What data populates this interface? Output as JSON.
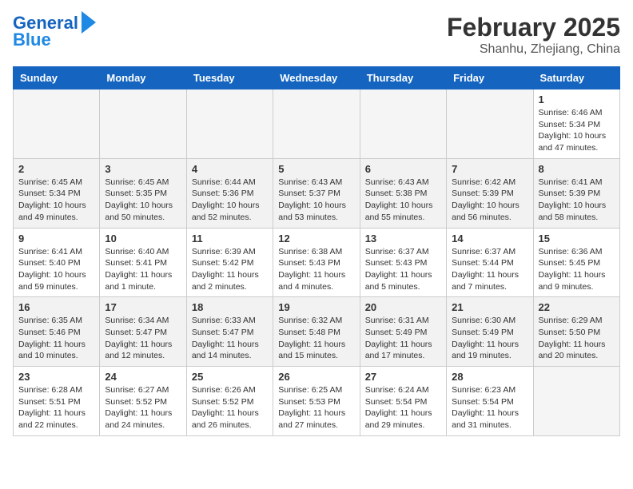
{
  "header": {
    "logo_line1": "General",
    "logo_line2": "Blue",
    "month_year": "February 2025",
    "location": "Shanhu, Zhejiang, China"
  },
  "weekdays": [
    "Sunday",
    "Monday",
    "Tuesday",
    "Wednesday",
    "Thursday",
    "Friday",
    "Saturday"
  ],
  "weeks": [
    [
      {
        "day": "",
        "empty": true
      },
      {
        "day": "",
        "empty": true
      },
      {
        "day": "",
        "empty": true
      },
      {
        "day": "",
        "empty": true
      },
      {
        "day": "",
        "empty": true
      },
      {
        "day": "",
        "empty": true
      },
      {
        "day": "1",
        "info": "Sunrise: 6:46 AM\nSunset: 5:34 PM\nDaylight: 10 hours and 47 minutes."
      }
    ],
    [
      {
        "day": "2",
        "info": "Sunrise: 6:45 AM\nSunset: 5:34 PM\nDaylight: 10 hours and 49 minutes."
      },
      {
        "day": "3",
        "info": "Sunrise: 6:45 AM\nSunset: 5:35 PM\nDaylight: 10 hours and 50 minutes."
      },
      {
        "day": "4",
        "info": "Sunrise: 6:44 AM\nSunset: 5:36 PM\nDaylight: 10 hours and 52 minutes."
      },
      {
        "day": "5",
        "info": "Sunrise: 6:43 AM\nSunset: 5:37 PM\nDaylight: 10 hours and 53 minutes."
      },
      {
        "day": "6",
        "info": "Sunrise: 6:43 AM\nSunset: 5:38 PM\nDaylight: 10 hours and 55 minutes."
      },
      {
        "day": "7",
        "info": "Sunrise: 6:42 AM\nSunset: 5:39 PM\nDaylight: 10 hours and 56 minutes."
      },
      {
        "day": "8",
        "info": "Sunrise: 6:41 AM\nSunset: 5:39 PM\nDaylight: 10 hours and 58 minutes."
      }
    ],
    [
      {
        "day": "9",
        "info": "Sunrise: 6:41 AM\nSunset: 5:40 PM\nDaylight: 10 hours and 59 minutes."
      },
      {
        "day": "10",
        "info": "Sunrise: 6:40 AM\nSunset: 5:41 PM\nDaylight: 11 hours and 1 minute."
      },
      {
        "day": "11",
        "info": "Sunrise: 6:39 AM\nSunset: 5:42 PM\nDaylight: 11 hours and 2 minutes."
      },
      {
        "day": "12",
        "info": "Sunrise: 6:38 AM\nSunset: 5:43 PM\nDaylight: 11 hours and 4 minutes."
      },
      {
        "day": "13",
        "info": "Sunrise: 6:37 AM\nSunset: 5:43 PM\nDaylight: 11 hours and 5 minutes."
      },
      {
        "day": "14",
        "info": "Sunrise: 6:37 AM\nSunset: 5:44 PM\nDaylight: 11 hours and 7 minutes."
      },
      {
        "day": "15",
        "info": "Sunrise: 6:36 AM\nSunset: 5:45 PM\nDaylight: 11 hours and 9 minutes."
      }
    ],
    [
      {
        "day": "16",
        "info": "Sunrise: 6:35 AM\nSunset: 5:46 PM\nDaylight: 11 hours and 10 minutes."
      },
      {
        "day": "17",
        "info": "Sunrise: 6:34 AM\nSunset: 5:47 PM\nDaylight: 11 hours and 12 minutes."
      },
      {
        "day": "18",
        "info": "Sunrise: 6:33 AM\nSunset: 5:47 PM\nDaylight: 11 hours and 14 minutes."
      },
      {
        "day": "19",
        "info": "Sunrise: 6:32 AM\nSunset: 5:48 PM\nDaylight: 11 hours and 15 minutes."
      },
      {
        "day": "20",
        "info": "Sunrise: 6:31 AM\nSunset: 5:49 PM\nDaylight: 11 hours and 17 minutes."
      },
      {
        "day": "21",
        "info": "Sunrise: 6:30 AM\nSunset: 5:49 PM\nDaylight: 11 hours and 19 minutes."
      },
      {
        "day": "22",
        "info": "Sunrise: 6:29 AM\nSunset: 5:50 PM\nDaylight: 11 hours and 20 minutes."
      }
    ],
    [
      {
        "day": "23",
        "info": "Sunrise: 6:28 AM\nSunset: 5:51 PM\nDaylight: 11 hours and 22 minutes."
      },
      {
        "day": "24",
        "info": "Sunrise: 6:27 AM\nSunset: 5:52 PM\nDaylight: 11 hours and 24 minutes."
      },
      {
        "day": "25",
        "info": "Sunrise: 6:26 AM\nSunset: 5:52 PM\nDaylight: 11 hours and 26 minutes."
      },
      {
        "day": "26",
        "info": "Sunrise: 6:25 AM\nSunset: 5:53 PM\nDaylight: 11 hours and 27 minutes."
      },
      {
        "day": "27",
        "info": "Sunrise: 6:24 AM\nSunset: 5:54 PM\nDaylight: 11 hours and 29 minutes."
      },
      {
        "day": "28",
        "info": "Sunrise: 6:23 AM\nSunset: 5:54 PM\nDaylight: 11 hours and 31 minutes."
      },
      {
        "day": "",
        "empty": true
      }
    ]
  ]
}
